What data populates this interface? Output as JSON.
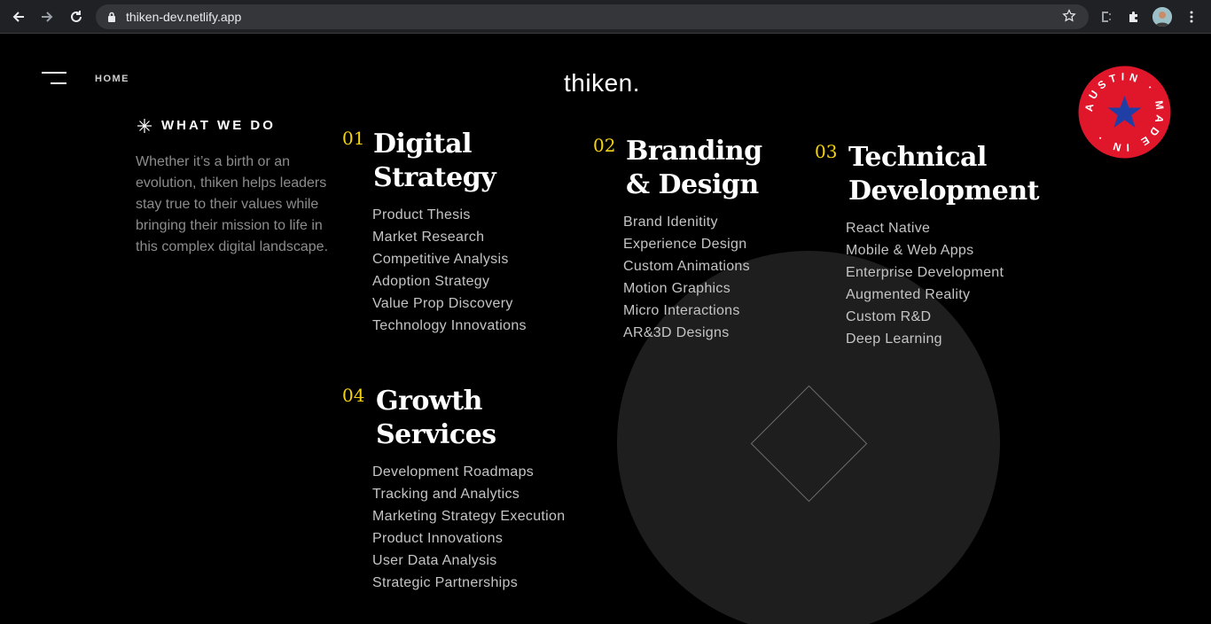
{
  "browser": {
    "url": "thiken-dev.netlify.app",
    "icons": [
      "back-icon",
      "forward-icon",
      "reload-icon",
      "lock-icon",
      "bookmark-star-icon",
      "extension-icon",
      "puzzle-icon",
      "profile-avatar",
      "more-icon"
    ]
  },
  "header": {
    "nav_label": "HOME",
    "logo": "thiken."
  },
  "badge": {
    "text": "AUSTIN · MADE IN ·",
    "color": "#e0162b",
    "star_color": "#1f3fa6"
  },
  "intro": {
    "heading": "WHAT WE DO",
    "text": "Whether it’s a birth or an evolution, thiken helps leaders stay true to their values while bringing their mission to life in this complex digital landscape."
  },
  "accent_color": "#f5d111",
  "services": [
    {
      "number": "01",
      "title_line1": "Digital",
      "title_line2": "Strategy",
      "items": [
        "Product Thesis",
        "Market Research",
        "Competitive Analysis",
        "Adoption Strategy",
        "Value Prop Discovery",
        "Technology Innovations"
      ]
    },
    {
      "number": "02",
      "title_line1": "Branding",
      "title_line2": "& Design",
      "items": [
        "Brand Idenitity",
        "Experience Design",
        "Custom Animations",
        "Motion Graphics",
        "Micro Interactions",
        "AR&3D Designs"
      ]
    },
    {
      "number": "03",
      "title_line1": "Technical",
      "title_line2": "Development",
      "items": [
        "React Native",
        "Mobile & Web Apps",
        "Enterprise Development",
        "Augmented Reality",
        "Custom R&D",
        "Deep Learning"
      ]
    },
    {
      "number": "04",
      "title_line1": "Growth",
      "title_line2": "Services",
      "items": [
        "Development Roadmaps",
        "Tracking and Analytics",
        "Marketing Strategy Execution",
        "Product Innovations",
        "User Data Analysis",
        "Strategic Partnerships"
      ]
    }
  ]
}
